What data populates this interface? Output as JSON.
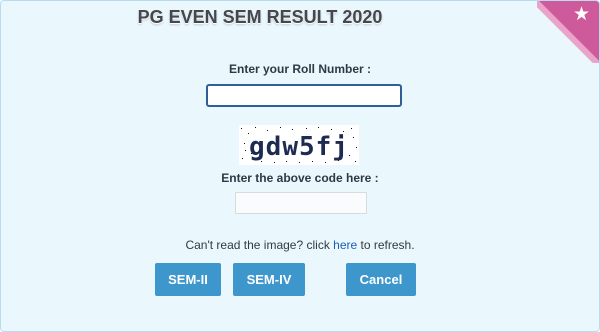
{
  "header": {
    "title": "PG EVEN SEM RESULT 2020",
    "corner_icon": "star-icon",
    "corner_color": "#cf5a9b"
  },
  "form": {
    "roll_label": "Enter your Roll Number :",
    "roll_value": "",
    "captcha_text": "gdw5fj",
    "code_label": "Enter the above code here :",
    "code_value": "",
    "refresh_prefix": "Can't read the image? click ",
    "refresh_link": "here",
    "refresh_suffix": " to refresh."
  },
  "buttons": {
    "sem2": "SEM-II",
    "sem4": "SEM-IV",
    "cancel": "Cancel",
    "color": "#3d97cc"
  }
}
